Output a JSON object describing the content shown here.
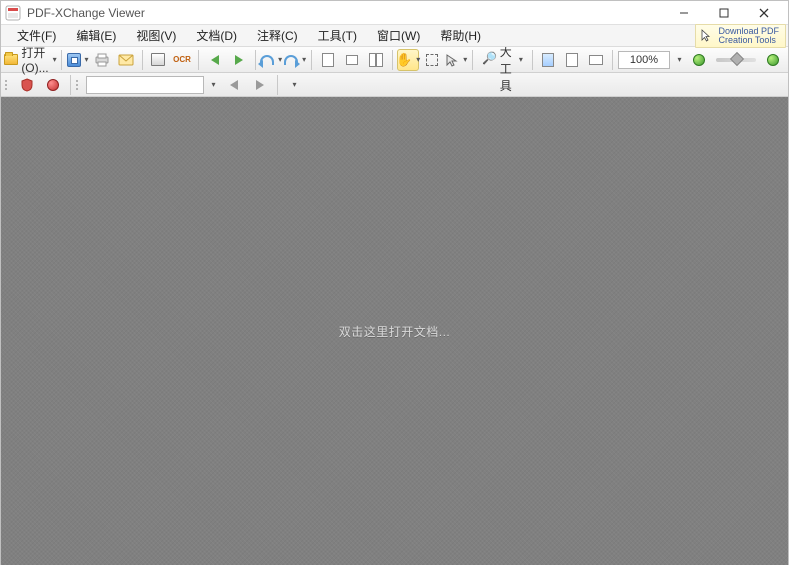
{
  "titlebar": {
    "title": "PDF-XChange Viewer"
  },
  "menu": {
    "file": "文件(F)",
    "edit": "编辑(E)",
    "view": "视图(V)",
    "document": "文档(D)",
    "comments": "注释(C)",
    "tools": "工具(T)",
    "window": "窗口(W)",
    "help": "帮助(H)"
  },
  "download": {
    "line1": "Download PDF",
    "line2": "Creation Tools"
  },
  "toolbar": {
    "open_label": "打开(O)...",
    "zoom_tool_label": "放大工具",
    "zoom_value": "100%"
  },
  "search": {
    "placeholder": ""
  },
  "doc_area": {
    "placeholder": "双击这里打开文档..."
  }
}
